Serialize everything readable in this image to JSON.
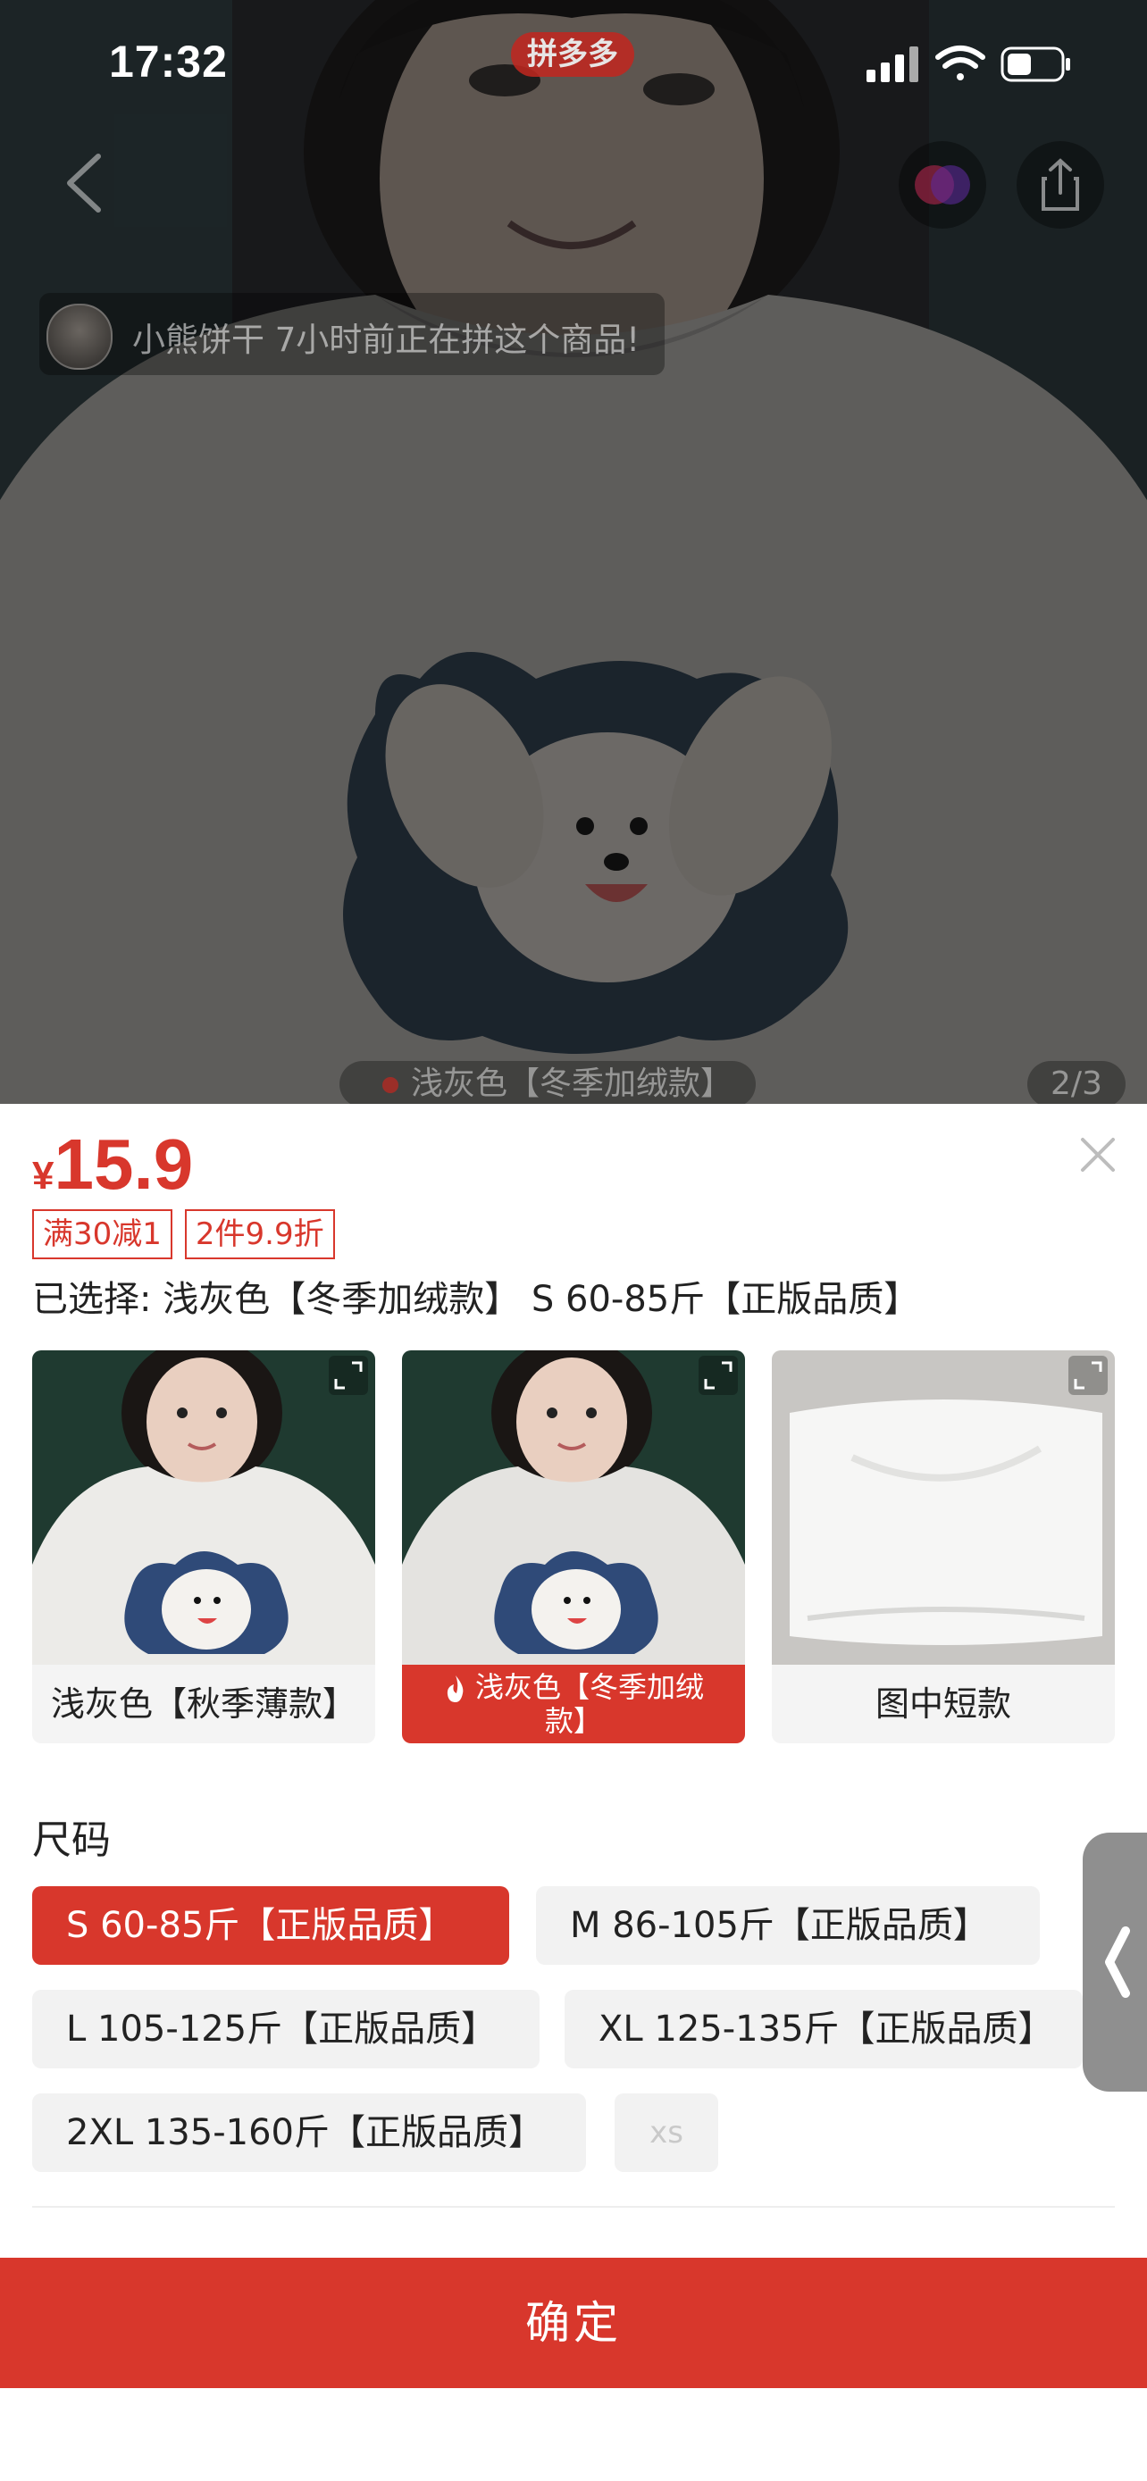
{
  "status_bar": {
    "time": "17:32",
    "app_pill": "拼多多"
  },
  "hero": {
    "notice_text": "小熊饼干 7小时前正在拼这个商品!",
    "image_caption": "浅灰色【冬季加绒款】",
    "counter": "2/3"
  },
  "sheet": {
    "currency": "¥",
    "price": "15.9",
    "badges": [
      "满30减1",
      "2件9.9折"
    ],
    "selected_text": "已选择: 浅灰色【冬季加绒款】 S 60-85斤【正版品质】",
    "color_options": [
      {
        "label": "浅灰色【秋季薄款】",
        "selected": false
      },
      {
        "label": "浅灰色【冬季加绒款】",
        "selected": true
      },
      {
        "label": "图中短款",
        "selected": false
      }
    ],
    "size_title": "尺码",
    "sizes": [
      {
        "label": "S 60-85斤【正版品质】",
        "selected": true
      },
      {
        "label": "M 86-105斤【正版品质】",
        "selected": false
      },
      {
        "label": "L 105-125斤【正版品质】",
        "selected": false
      },
      {
        "label": "XL 125-135斤【正版品质】",
        "selected": false
      },
      {
        "label": "2XL 135-160斤【正版品质】",
        "selected": false
      },
      {
        "label": "xs",
        "disabled": true
      }
    ],
    "confirm_label": "确定"
  },
  "colors": {
    "accent": "#d8372c",
    "chip_bg": "#f2f2f2"
  },
  "icons": [
    "back-arrow-icon",
    "signal-icon",
    "wifi-icon",
    "battery-icon",
    "merge-icon",
    "share-icon",
    "close-icon",
    "expand-icon",
    "flame-icon",
    "chevron-left-icon"
  ]
}
